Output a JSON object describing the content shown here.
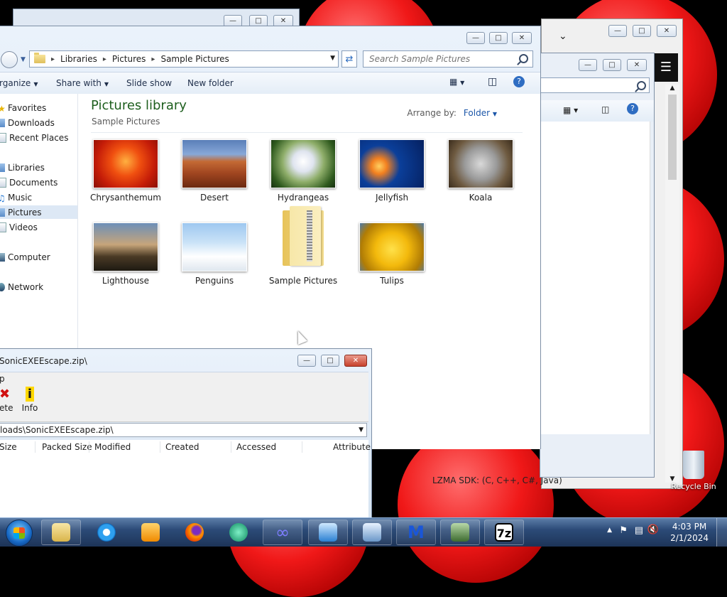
{
  "explorer": {
    "breadcrumb": [
      "Libraries",
      "Pictures",
      "Sample Pictures"
    ],
    "search_placeholder": "Search Sample Pictures",
    "commands": {
      "organize": "rganize",
      "share_with": "Share with",
      "slide_show": "Slide show",
      "new_folder": "New folder"
    },
    "nav": {
      "favorites": "Favorites",
      "downloads": "Downloads",
      "recent_places": "Recent Places",
      "libraries": "Libraries",
      "documents": "Documents",
      "music": "Music",
      "pictures": "Pictures",
      "videos": "Videos",
      "computer": "Computer",
      "network": "Network"
    },
    "library_title": "Pictures library",
    "library_subtitle": "Sample Pictures",
    "arrange_label": "Arrange by:",
    "arrange_value": "Folder",
    "items": [
      "Chrysanthemum",
      "Desert",
      "Hydrangeas",
      "Jellyfish",
      "Koala",
      "Lighthouse",
      "Penguins",
      "Sample Pictures",
      "Tulips"
    ]
  },
  "sevenzip": {
    "title": "SonicEXEEscape.zip\\",
    "menu": "p",
    "tool_delete": "ete",
    "tool_info": "Info",
    "path": "loads\\SonicEXEEscape.zip\\",
    "columns": [
      "Size",
      "Packed Size",
      "Modified",
      "Created",
      "Accessed",
      "Attribute"
    ]
  },
  "back_window_text": "LZMA SDK: (C, C++, C#, Java)",
  "desktop": {
    "recycle_bin": "Recycle Bin"
  },
  "taskbar": {
    "time": "4:03 PM",
    "date": "2/1/2024"
  },
  "colors": {
    "library_title": "#1e5f1e",
    "link_blue": "#1a55a8",
    "close_red": "#c7412c",
    "desktop_ball": "#f01818"
  }
}
